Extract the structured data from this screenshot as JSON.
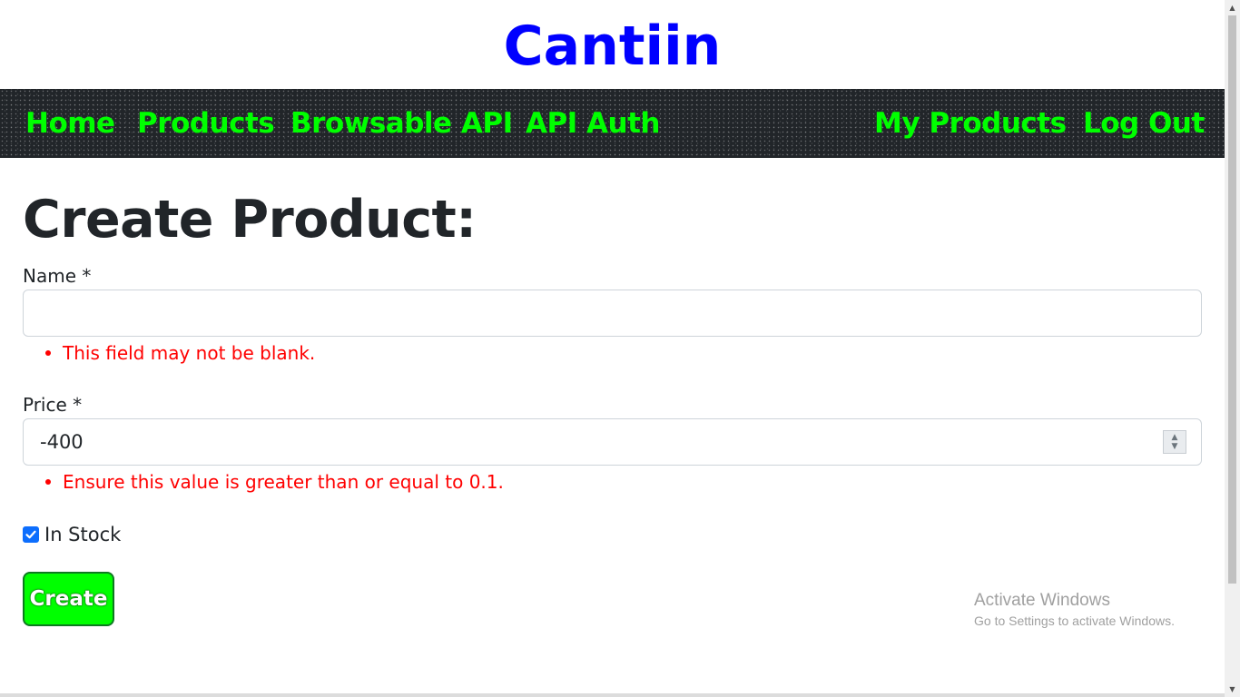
{
  "site": {
    "title": "Cantiin"
  },
  "nav": {
    "left": [
      "Home",
      "Products",
      "Browsable API",
      "API Auth"
    ],
    "right": [
      "My Products",
      "Log Out"
    ],
    "link_color": "#00ff00"
  },
  "form": {
    "heading": "Create Product:",
    "name": {
      "label": "Name *",
      "value": "",
      "error": "This field may not be blank."
    },
    "price": {
      "label": "Price *",
      "value": "-400",
      "error": "Ensure this value is greater than or equal to 0.1."
    },
    "in_stock": {
      "label": "In Stock",
      "checked": true
    },
    "submit_label": "Create"
  },
  "watermark": {
    "title": "Activate Windows",
    "subtitle": "Go to Settings to activate Windows."
  },
  "colors": {
    "title": "#0000ff",
    "navbar_bg": "#212529",
    "error": "#ff0000",
    "button_bg": "#00ff00"
  }
}
